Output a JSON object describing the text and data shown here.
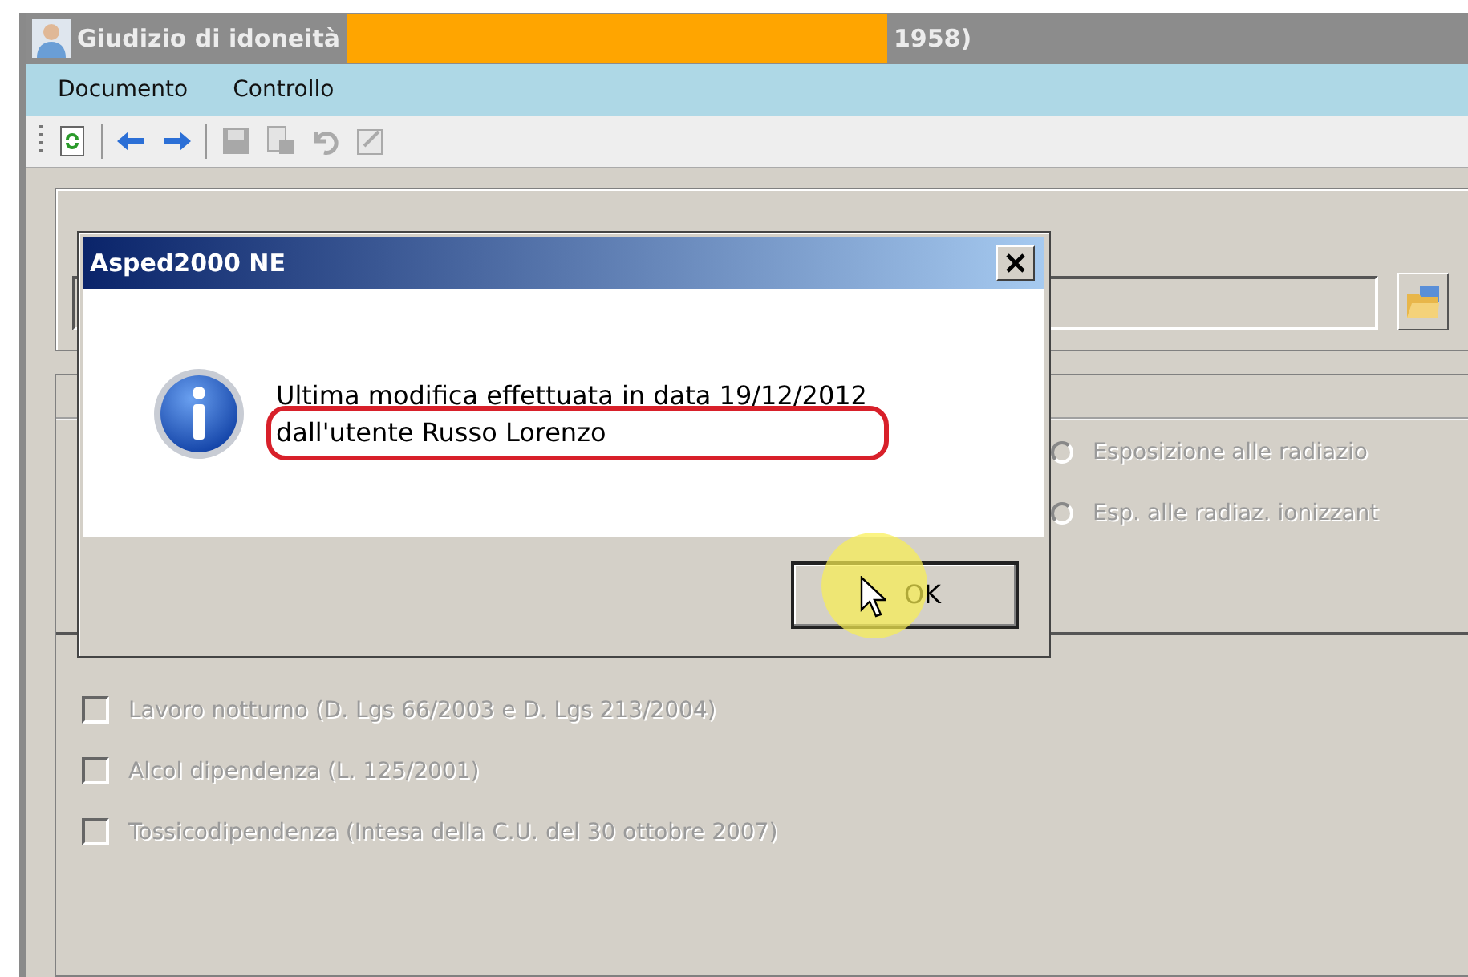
{
  "window": {
    "title": "Giudizio di idoneità",
    "title_tail": "1958)",
    "redacted": true
  },
  "menu": [
    {
      "label": "Documento"
    },
    {
      "label": "Controllo"
    }
  ],
  "toolbar": [
    {
      "kind": "refresh",
      "disabled": false
    },
    {
      "kind": "separator"
    },
    {
      "kind": "back",
      "disabled": false
    },
    {
      "kind": "forward",
      "disabled": false
    },
    {
      "kind": "separator"
    },
    {
      "kind": "save",
      "disabled": true
    },
    {
      "kind": "copy",
      "disabled": true
    },
    {
      "kind": "undo",
      "disabled": true
    },
    {
      "kind": "edit",
      "disabled": true
    }
  ],
  "exposure_options": [
    {
      "label": "Esposizione alle radiazio",
      "selected": false,
      "disabled": true
    },
    {
      "label": "Esp. alle radiaz. ionizzant",
      "selected": false,
      "disabled": true
    }
  ],
  "checkboxes": [
    {
      "label": "Lavoro notturno (D. Lgs 66/2003 e D. Lgs 213/2004)",
      "checked": false,
      "disabled": true
    },
    {
      "label": "Alcol dipendenza (L. 125/2001)",
      "checked": false,
      "disabled": true
    },
    {
      "label": "Tossicodipendenza (Intesa della C.U. del 30 ottobre 2007)",
      "checked": false,
      "disabled": true
    }
  ],
  "dialog": {
    "title": "Asped2000 NE",
    "lines": [
      {
        "text": "Ultima modifica effettuata in data 19/12/2012",
        "circled": false
      },
      {
        "text": "dall'utente Russo Lorenzo",
        "circled": true
      }
    ],
    "button": "OK"
  }
}
